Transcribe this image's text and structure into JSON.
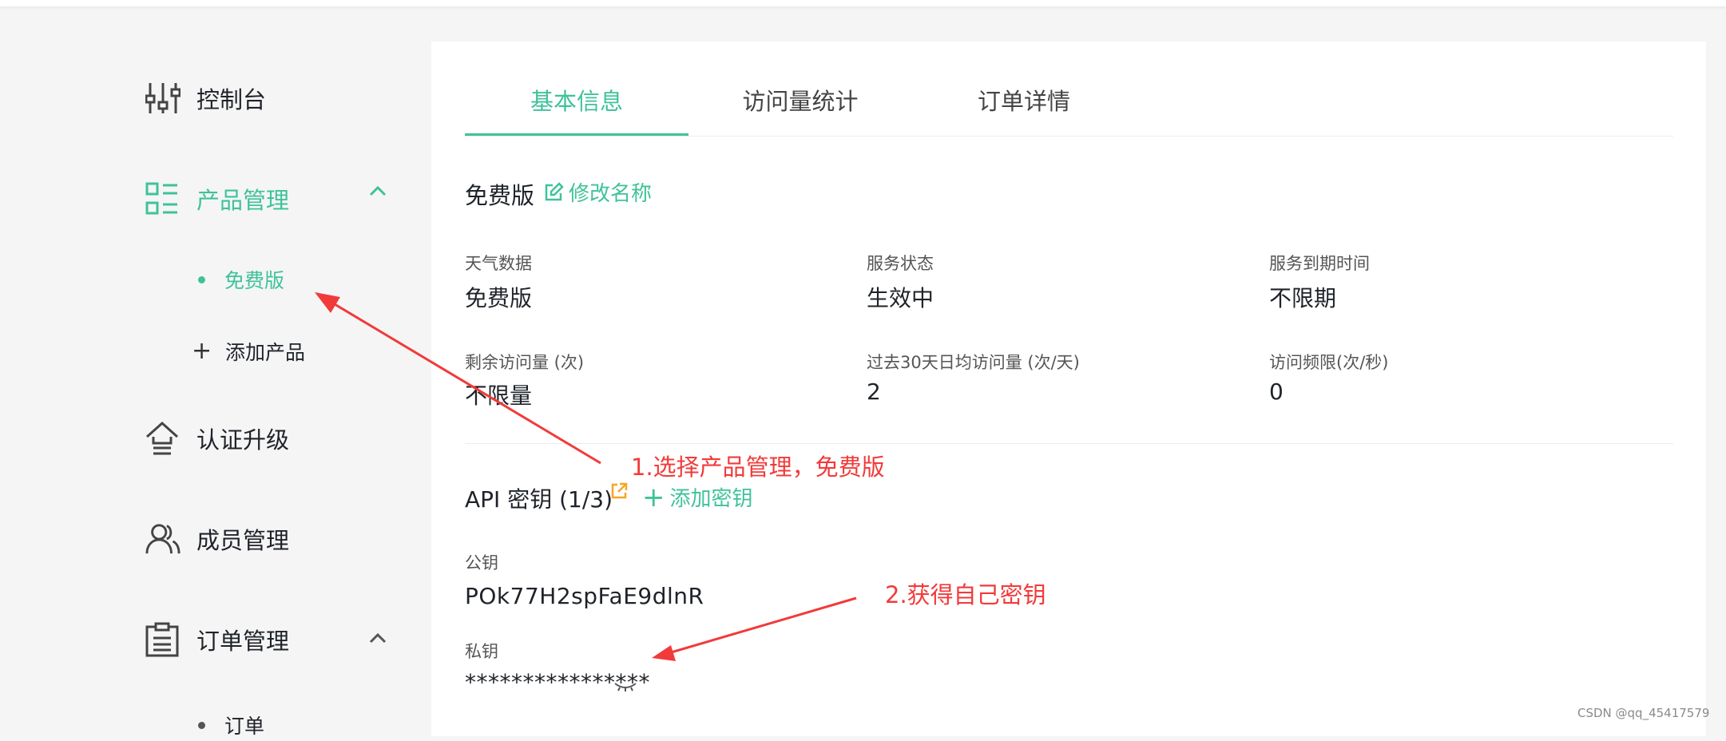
{
  "sidebar": {
    "items": [
      {
        "label": "控制台",
        "icon": "sliders-icon"
      },
      {
        "label": "产品管理",
        "icon": "product-list-icon",
        "active": true,
        "expanded": true
      },
      {
        "label": "认证升级",
        "icon": "upgrade-icon"
      },
      {
        "label": "成员管理",
        "icon": "members-icon"
      },
      {
        "label": "订单管理",
        "icon": "order-icon",
        "expanded": true
      }
    ],
    "product_sub": [
      {
        "label": "免费版",
        "active": true
      },
      {
        "label": "添加产品",
        "icon": "plus-icon"
      }
    ],
    "order_sub": [
      {
        "label": "订单"
      }
    ]
  },
  "tabs": [
    {
      "label": "基本信息",
      "active": true
    },
    {
      "label": "访问量统计"
    },
    {
      "label": "订单详情"
    }
  ],
  "product": {
    "name": "免费版",
    "rename_label": "修改名称"
  },
  "info": [
    {
      "label": "天气数据",
      "value": "免费版"
    },
    {
      "label": "服务状态",
      "value": "生效中"
    },
    {
      "label": "服务到期时间",
      "value": "不限期"
    },
    {
      "label": "剩余访问量 (次)",
      "value": "不限量"
    },
    {
      "label": "过去30天日均访问量 (次/天)",
      "value": "2"
    },
    {
      "label": "访问频限(次/秒)",
      "value": "0"
    }
  ],
  "api": {
    "title": "API 密钥 (1/3)",
    "add_label": "添加密钥",
    "public_key_label": "公钥",
    "public_key": "POk77H2spFaE9dlnR",
    "private_key_label": "私钥",
    "private_key": "****************"
  },
  "annotations": {
    "step1": "1.选择产品管理，免费版",
    "step2": "2.获得自己密钥"
  },
  "watermark": "CSDN @qq_45417579",
  "colors": {
    "accent": "#3fc29a",
    "annotation": "#f23a3a",
    "external_link": "#f5a623"
  }
}
